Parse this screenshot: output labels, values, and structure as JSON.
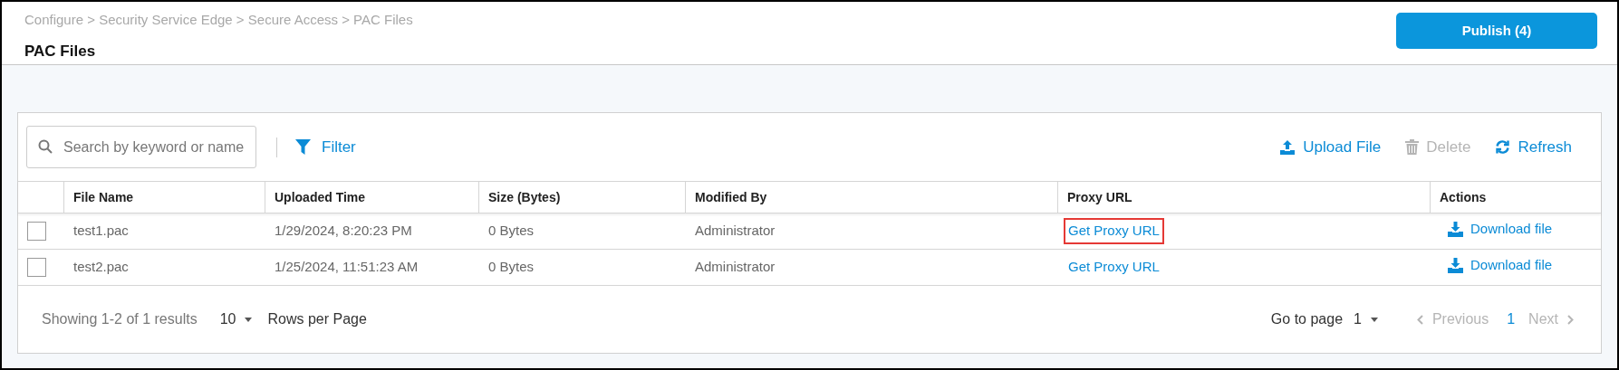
{
  "breadcrumb": "Configure > Security Service Edge > Secure Access > PAC Files",
  "title": "PAC Files",
  "publish_button": "Publish (4)",
  "search": {
    "placeholder": "Search by keyword or name"
  },
  "filter_button": "Filter",
  "toolbar_actions": [
    {
      "kind": "upload",
      "label": "Upload File",
      "disabled": false
    },
    {
      "kind": "delete",
      "label": "Delete",
      "disabled": true
    },
    {
      "kind": "refresh",
      "label": "Refresh",
      "disabled": false
    }
  ],
  "table": {
    "columns": [
      "File Name",
      "Uploaded Time",
      "Size (Bytes)",
      "Modified By",
      "Proxy URL",
      "Actions"
    ],
    "rows": [
      {
        "checked": false,
        "file_name": "test1.pac",
        "uploaded_time": "1/29/2024, 8:20:23 PM",
        "size": "0 Bytes",
        "modified_by": "Administrator",
        "proxy_url": "Get Proxy URL",
        "proxy_url_highlighted": true,
        "action": "Download file"
      },
      {
        "checked": false,
        "file_name": "test2.pac",
        "uploaded_time": "1/25/2024, 11:51:23 AM",
        "size": "0 Bytes",
        "modified_by": "Administrator",
        "proxy_url": "Get Proxy URL",
        "proxy_url_highlighted": false,
        "action": "Download file"
      }
    ]
  },
  "footer": {
    "showing": "Showing 1-2 of 1 results",
    "rows_per_page_value": "10",
    "rows_per_page_label": "Rows per Page",
    "go_to_page_label": "Go to page",
    "go_to_page_value": "1",
    "previous": {
      "label": "Previous",
      "disabled": true
    },
    "pages": [
      {
        "label": "1",
        "selected": true
      }
    ],
    "next": {
      "label": "Next",
      "disabled": true
    }
  }
}
